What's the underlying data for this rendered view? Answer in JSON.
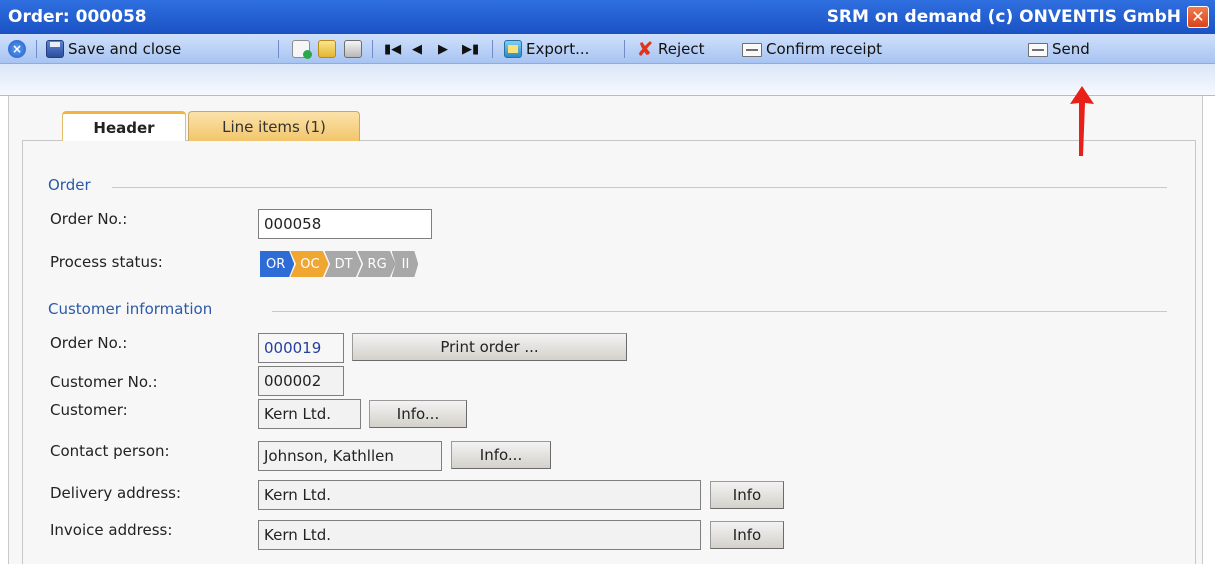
{
  "window": {
    "title": "Order: 000058",
    "brand": "SRM on demand (c) ONVENTIS GmbH",
    "close_glyph": "✕"
  },
  "toolbar": {
    "save_close": "Save and close",
    "export": "Export...",
    "reject": "Reject",
    "confirm_receipt": "Confirm receipt",
    "send": "Send",
    "icons": [
      "close-circle-icon",
      "save-icon",
      "document-icon",
      "folder-icon",
      "print-icon",
      "first-icon",
      "previous-icon",
      "next-icon",
      "last-icon",
      "export-icon",
      "reject-icon",
      "mail-icon"
    ]
  },
  "tabs": [
    {
      "label": "Header",
      "active": true
    },
    {
      "label": "Line items (1)",
      "active": false
    }
  ],
  "order": {
    "section": "Order",
    "order_no_label": "Order No.:",
    "order_no_value": "000058",
    "process_status_label": "Process status:",
    "process_status": [
      {
        "code": "OR",
        "color": "#2d6bd6"
      },
      {
        "code": "OC",
        "color": "#f0a732"
      },
      {
        "code": "DT",
        "color": "#a8a8a8"
      },
      {
        "code": "RG",
        "color": "#a8a8a8"
      },
      {
        "code": "II",
        "color": "#a8a8a8"
      }
    ]
  },
  "customer": {
    "section": "Customer information",
    "order_no_label": "Order No.:",
    "order_no_value": "000019",
    "print_order": "Print order ...",
    "customer_no_label": "Customer No.:",
    "customer_no_value": "000002",
    "customer_label": "Customer:",
    "customer_value": "Kern Ltd.",
    "contact_label": "Contact person:",
    "contact_value": "Johnson, Kathllen",
    "delivery_label": "Delivery address:",
    "delivery_value": "Kern Ltd.",
    "invoice_label": "Invoice address:",
    "invoice_value": "Kern Ltd.",
    "info_dots": "Info...",
    "info": "Info"
  },
  "colors": {
    "titlebar": "#1f5fd0",
    "section_title": "#2b5aa8",
    "arrow": "#e8201a"
  }
}
